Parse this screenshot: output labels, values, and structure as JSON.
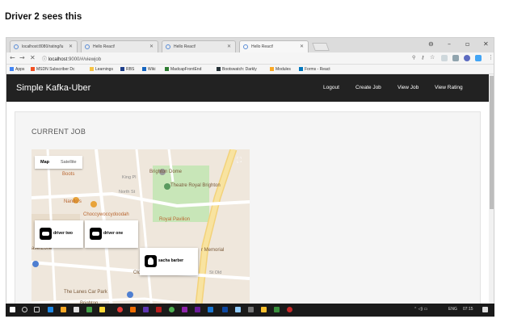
{
  "caption": "Driver 2 sees this",
  "browser": {
    "tabs": [
      {
        "label": "localhost:8080/rating/lu",
        "active": false
      },
      {
        "label": "Hello React!",
        "active": false
      },
      {
        "label": "Hello React!",
        "active": false
      },
      {
        "label": "Hello React!",
        "active": true
      }
    ],
    "url_host": "localhost",
    "url_path": ":9000/#/viewjob",
    "bookmarks": [
      "Apps",
      "MSDN Subscriber Dc",
      "Learnings",
      "RBS",
      "Wiki",
      "MadcapFrontEnd",
      "Bootswatch: Darkly",
      "Modules",
      "Forms - React"
    ]
  },
  "app": {
    "brand": "Simple Kafka-Uber",
    "nav": [
      "Logout",
      "Create Job",
      "View Job",
      "View Rating"
    ]
  },
  "panel": {
    "title": "CURRENT JOB"
  },
  "map": {
    "toggle": [
      "Map",
      "Satellite"
    ],
    "labels": [
      {
        "text": "Boots",
        "cls": "red"
      },
      {
        "text": "King Pl",
        "cls": "street"
      },
      {
        "text": "Brighton Dome",
        "cls": ""
      },
      {
        "text": "Theatre Royal Brighton",
        "cls": ""
      },
      {
        "text": "North St",
        "cls": "street"
      },
      {
        "text": "Nando's",
        "cls": "red"
      },
      {
        "text": "Choccywoccydoodah",
        "cls": "red"
      },
      {
        "text": "Royal Pavilion",
        "cls": "red"
      },
      {
        "text": "aserZone",
        "cls": ""
      },
      {
        "text": "r Memorial",
        "cls": ""
      },
      {
        "text": "Old Police Ce",
        "cls": ""
      },
      {
        "text": "St Old",
        "cls": "street"
      },
      {
        "text": "The Lanes Car Park",
        "cls": ""
      },
      {
        "text": "Brighton",
        "cls": ""
      }
    ],
    "markers": [
      {
        "name": "driver two",
        "kind": "car"
      },
      {
        "name": "driver one",
        "kind": "car"
      },
      {
        "name": "sacha barber",
        "kind": "person"
      }
    ]
  },
  "tray": {
    "lang": "ENG",
    "time": "07:15"
  }
}
